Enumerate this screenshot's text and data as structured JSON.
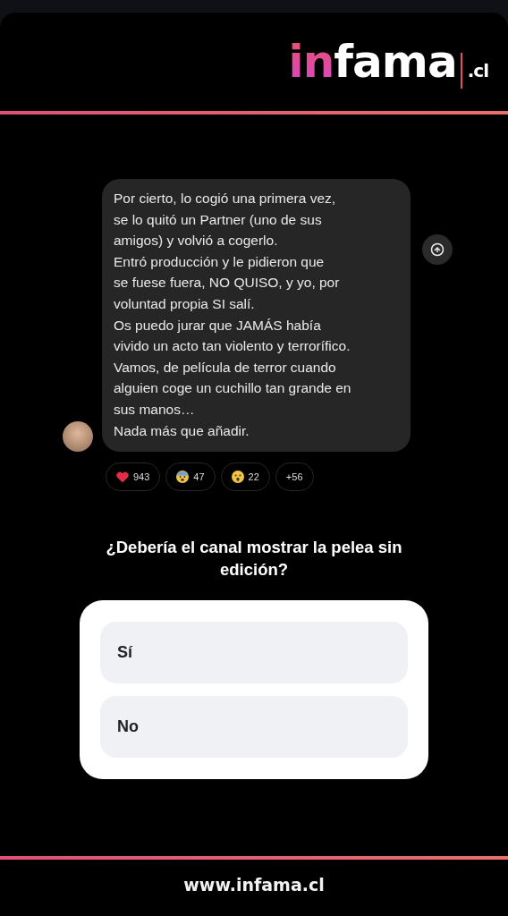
{
  "logo": {
    "prefix": "in",
    "name": "fama",
    "suffix": ".cl"
  },
  "message": {
    "text": "Por cierto, lo cogió una primera vez,\nse lo quitó un Partner (uno de sus\namigos) y volvió a cogerlo.\nEntró producción y le pidieron que\nse fuese fuera, NO QUISO, y yo, por\nvoluntad propia SI salí.\nOs puedo jurar que JAMÁS había\nvivido un acto tan violento y terrorífico.\nVamos, de película de terror cuando\nalguien coge un cuchillo tan grande en\nsus manos…\nNada más que añadir."
  },
  "reactions": [
    {
      "kind": "heart",
      "count": "943"
    },
    {
      "kind": "fear",
      "count": "47"
    },
    {
      "kind": "surprised",
      "count": "22"
    },
    {
      "kind": "more",
      "count": "+56"
    }
  ],
  "poll": {
    "question": "¿Debería el canal mostrar la pelea sin edición?",
    "options": [
      {
        "label": "Sí"
      },
      {
        "label": "No"
      }
    ]
  },
  "footer": {
    "url": "www.infama.cl"
  }
}
